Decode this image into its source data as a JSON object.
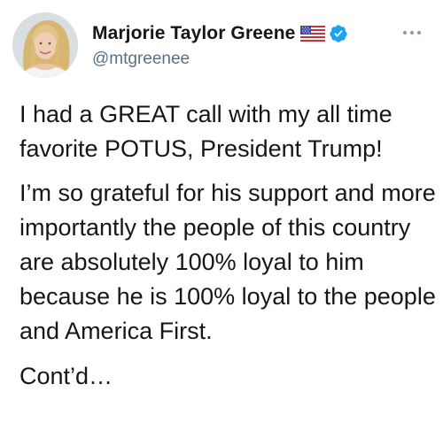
{
  "tweet": {
    "author": {
      "display_name": "Marjorie Taylor Greene",
      "handle": "@mtgreenee",
      "flag_icon": "us-flag-icon",
      "verified_icon": "verified-badge-icon",
      "avatar_icon": "profile-photo"
    },
    "more_icon": "more-options-icon",
    "paragraphs": [
      "I had a GREAT call with my all time favorite POTUS, President Trump!",
      "I’m so grateful for his support and more importantly the people of this country are absolutely 100% loyal to him because he is 100% loyal to the people and America First.",
      "Cont’d…"
    ]
  },
  "colors": {
    "text": "#14171a",
    "secondary_text": "#5b7083",
    "verified_blue": "#1da1f2",
    "background": "#ffffff"
  }
}
